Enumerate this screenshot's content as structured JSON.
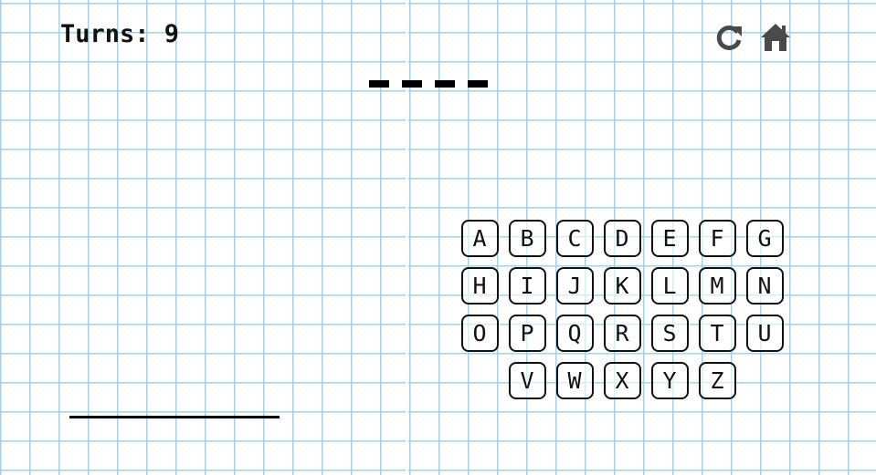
{
  "header": {
    "turns_text": "Turns: 9"
  },
  "controls": {
    "restart_icon": "restart-icon",
    "home_icon": "home-icon",
    "icon_color": "#4a4a4a"
  },
  "word": {
    "blanks": [
      "_",
      "_",
      "_",
      "_"
    ]
  },
  "keyboard": {
    "rows": [
      [
        "A",
        "B",
        "C",
        "D",
        "E",
        "F",
        "G"
      ],
      [
        "H",
        "I",
        "J",
        "K",
        "L",
        "M",
        "N"
      ],
      [
        "O",
        "P",
        "Q",
        "R",
        "S",
        "T",
        "U"
      ],
      [
        "V",
        "W",
        "X",
        "Y",
        "Z"
      ]
    ]
  },
  "colors": {
    "grid_line": "#9fd4ec",
    "background": "#ffffff",
    "ink": "#111111"
  }
}
